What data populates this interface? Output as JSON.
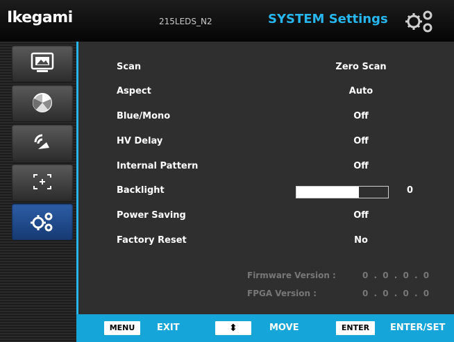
{
  "header": {
    "brand": "Ikegami",
    "model": "215LEDS_N2",
    "title": "SYSTEM Settings",
    "icon": "gear-icon"
  },
  "sidebar": {
    "tabs": [
      {
        "icon": "picture-icon",
        "active": false
      },
      {
        "icon": "color-wheel-icon",
        "active": false
      },
      {
        "icon": "audio-icon",
        "active": false
      },
      {
        "icon": "marker-icon",
        "active": false
      },
      {
        "icon": "gear-icon",
        "active": true
      }
    ]
  },
  "settings": {
    "scan": {
      "label": "Scan",
      "value": "Zero Scan"
    },
    "aspect": {
      "label": "Aspect",
      "value": "Auto"
    },
    "blue_mono": {
      "label": "Blue/Mono",
      "value": "Off"
    },
    "hv_delay": {
      "label": "HV Delay",
      "value": "Off"
    },
    "internal_pattern": {
      "label": "Internal Pattern",
      "value": "Off"
    },
    "backlight": {
      "label": "Backlight",
      "value": "0",
      "level": 0.68
    },
    "power_saving": {
      "label": "Power Saving",
      "value": "Off"
    },
    "factory_reset": {
      "label": "Factory Reset",
      "value": "No"
    }
  },
  "versions": {
    "firmware_label": "Firmware Version :",
    "firmware_value": "0 . 0 . 0 . 0",
    "fpga_label": "FPGA Version :",
    "fpga_value": "0 . 0 . 0 . 0"
  },
  "footer": {
    "menu_key": "MENU",
    "menu_action": "EXIT",
    "move_key": "⬍",
    "move_action": "MOVE",
    "enter_key": "ENTER",
    "enter_action": "ENTER/SET"
  },
  "colors": {
    "accent": "#27b7ee",
    "footer": "#16a5d9",
    "active_tab": "#2d5ea8"
  }
}
